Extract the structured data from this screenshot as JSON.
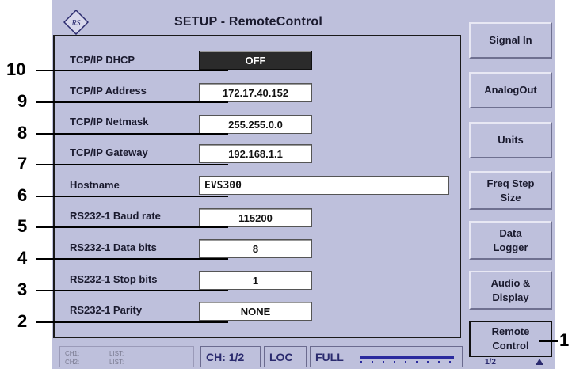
{
  "window": {
    "title": "SETUP - RemoteControl"
  },
  "settings": [
    {
      "label": "TCP/IP DHCP",
      "value": "OFF"
    },
    {
      "label": "TCP/IP Address",
      "value": "172.17.40.152"
    },
    {
      "label": "TCP/IP Netmask",
      "value": "255.255.0.0"
    },
    {
      "label": "TCP/IP Gateway",
      "value": "192.168.1.1"
    },
    {
      "label": "Hostname",
      "value": "EVS300"
    },
    {
      "label": "RS232-1  Baud rate",
      "value": "115200"
    },
    {
      "label": "RS232-1  Data bits",
      "value": "8"
    },
    {
      "label": "RS232-1  Stop bits",
      "value": "1"
    },
    {
      "label": "RS232-1  Parity",
      "value": "NONE"
    }
  ],
  "softkeys": [
    {
      "label": "Signal In"
    },
    {
      "label": "AnalogOut"
    },
    {
      "label": "Units"
    },
    {
      "label": "Freq Step\nSize"
    },
    {
      "label": "Data\nLogger"
    },
    {
      "label": "Audio &\nDisplay"
    },
    {
      "label": "Remote\nControl"
    }
  ],
  "page_indicator": "1/2",
  "status_bar": {
    "ch1": "CH1:",
    "ch2": "CH2:",
    "list1": "LIST:",
    "list2": "LIST:",
    "channel": "CH: 1/2",
    "mode": "LOC",
    "range": "FULL"
  },
  "callouts": [
    "10",
    "9",
    "8",
    "7",
    "6",
    "5",
    "4",
    "3",
    "2",
    "1"
  ],
  "colors": {
    "screen_bg": "#bec0dc",
    "active_field_bg": "#2b2b2b",
    "text_dark": "#1a1a2e",
    "status_blue": "#2a2a9e"
  }
}
